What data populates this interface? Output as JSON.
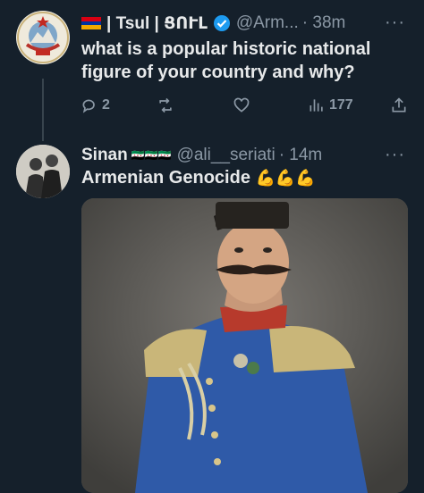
{
  "tweet1": {
    "flag_icon": "armenia-flag-icon",
    "name": "| Tsul | ՑՈՒԼ",
    "handle": "@Arm...",
    "time": "· 38m",
    "text_line1": "what is a popular historic national",
    "text_line2": "figure of your country and why?",
    "replies": "2",
    "views": "177",
    "verified_color": "#1d9bf0"
  },
  "tweet2": {
    "name": "Sinan",
    "name_suffix": "🇸🇾🇸🇾🇸🇾",
    "handle": "@ali__seriati",
    "time": "· 14m",
    "text": "Armenian Genocide",
    "emoji": "💪💪💪"
  },
  "more_label": "···",
  "colors": {
    "background": "#15202b",
    "text": "#e7e9ea",
    "muted": "#8b98a5"
  }
}
